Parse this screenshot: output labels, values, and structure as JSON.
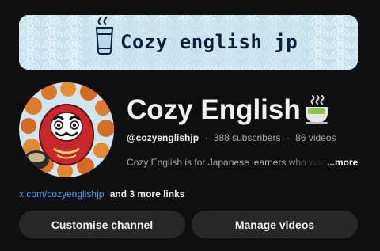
{
  "banner": {
    "title": "Cozy english jp"
  },
  "channel": {
    "name": "Cozy English",
    "handle": "@cozyenglishjp",
    "subscribers": "388 subscribers",
    "videos": "86 videos",
    "separator": "·",
    "description": "Cozy English is for Japanese learners who want",
    "more_label": "...more"
  },
  "links": {
    "primary": "x.com/cozyenglishjp",
    "extra": "and 3 more links"
  },
  "actions": {
    "customise_label": "Customise channel",
    "manage_label": "Manage videos"
  },
  "colors": {
    "background": "#0f0f0f",
    "button": "#272727",
    "link": "#3ea6ff",
    "banner": "#c7e2ee"
  },
  "icons": {
    "banner_cup": "cup-icon",
    "tea": "tea-cup-emoji-icon",
    "avatar": "daruma-avatar"
  }
}
